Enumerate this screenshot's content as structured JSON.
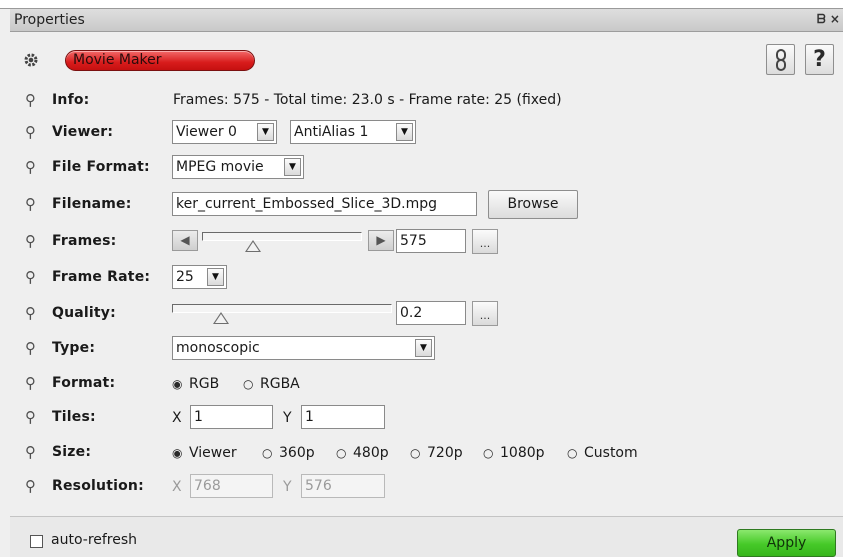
{
  "panel": {
    "title": "Properties",
    "window_controls": "ᗷ ×"
  },
  "module": {
    "icon": "gear-icon",
    "name": "Movie Maker",
    "color": "#d81c1c",
    "help_label": "?",
    "lock_icon": "chain-link-icon"
  },
  "params": {
    "info": {
      "label": "Info:",
      "value": "Frames: 575 - Total time: 23.0 s - Frame rate: 25 (fixed)"
    },
    "viewer": {
      "label": "Viewer:",
      "viewer_selected": "Viewer 0",
      "antialias_selected": "AntiAlias 1"
    },
    "file_format": {
      "label": "File Format:",
      "selected": "MPEG movie"
    },
    "filename": {
      "label": "Filename:",
      "value": "ker_current_Embossed_Slice_3D.mpg",
      "browse_label": "Browse"
    },
    "frames": {
      "label": "Frames:",
      "value": "575",
      "dots": "...",
      "slider_fraction": 0.3
    },
    "frame_rate": {
      "label": "Frame Rate:",
      "selected": "25"
    },
    "quality": {
      "label": "Quality:",
      "value": "0.2",
      "dots": "...",
      "slider_fraction": 0.2
    },
    "type": {
      "label": "Type:",
      "selected": "monoscopic"
    },
    "format": {
      "label": "Format:",
      "options": [
        "RGB",
        "RGBA"
      ],
      "selected": "RGB"
    },
    "tiles": {
      "label": "Tiles:",
      "x_label": "X",
      "x_value": "1",
      "y_label": "Y",
      "y_value": "1"
    },
    "size": {
      "label": "Size:",
      "options": [
        "Viewer",
        "360p",
        "480p",
        "720p",
        "1080p",
        "Custom"
      ],
      "selected": "Viewer"
    },
    "resolution": {
      "label": "Resolution:",
      "x_label": "X",
      "x_value": "768",
      "y_label": "Y",
      "y_value": "576"
    }
  },
  "footer": {
    "auto_refresh_label": "auto-refresh",
    "auto_refresh_checked": false,
    "apply_label": "Apply",
    "apply_color": "#46c928"
  }
}
